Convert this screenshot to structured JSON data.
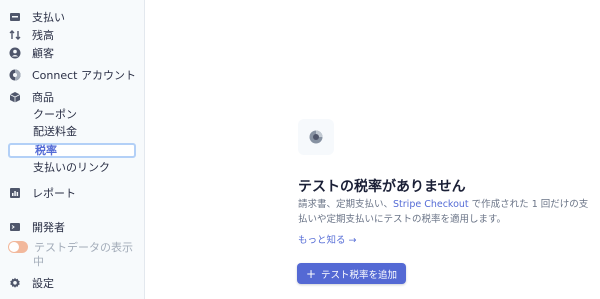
{
  "sidebar": {
    "items": [
      {
        "label": "支払い",
        "icon": "wallet-icon"
      },
      {
        "label": "残高",
        "icon": "transfer-arrows-icon"
      },
      {
        "label": "顧客",
        "icon": "user-icon"
      },
      {
        "label": "Connect アカウント",
        "icon": "connect-icon"
      },
      {
        "label": "商品",
        "icon": "box-icon"
      }
    ],
    "sub_items": [
      "クーポン",
      "配送料金",
      "税率",
      "支払いのリンク"
    ],
    "active_sub_item": "税率",
    "reports": {
      "label": "レポート",
      "icon": "report-icon"
    },
    "developers": {
      "label": "開発者",
      "icon": "terminal-icon"
    },
    "test_mode": {
      "line1": "テストデータの表示",
      "line2": "中"
    },
    "settings": {
      "label": "設定",
      "icon": "gear-icon"
    }
  },
  "main": {
    "empty_state": {
      "title": "テストの税率がありません",
      "desc_part1": "請求書、定期支払い、",
      "desc_link": "Stripe Checkout",
      "desc_part2": " で作成された 1 回だけの支払いや定期支払いにテストの税率を適用します。",
      "learn_more": "もっと知る →",
      "button_label": "テスト税率を追加",
      "button_icon": "plus-icon",
      "icon": "tax-rate-icon"
    }
  },
  "colors": {
    "accent": "#5469d4",
    "link": "#556cd6",
    "sidebar_bg": "#f7fafc",
    "toggle": "#f2b89c"
  }
}
